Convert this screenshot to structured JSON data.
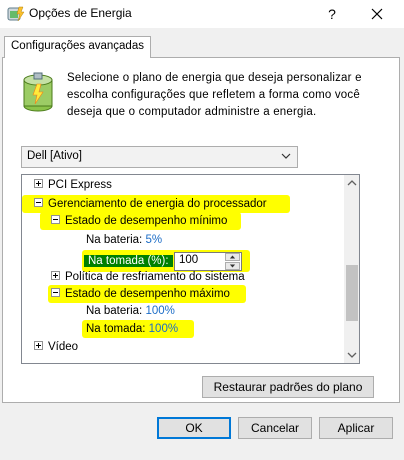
{
  "window": {
    "title": "Opções de Energia",
    "help_label": "?"
  },
  "tab": {
    "label": "Configurações avançadas"
  },
  "description": "Selecione o plano de energia que deseja personalizar e escolha configurações que refletem a forma como você deseja que o computador administre a energia.",
  "plan_dropdown": {
    "selected": "Dell [Ativo]"
  },
  "tree": {
    "pci_express": "PCI Express",
    "cpu_power": "Gerenciamento de energia do processador",
    "min_state": "Estado de desempenho mínimo",
    "min_battery_label": "Na bateria:",
    "min_battery_value": "5%",
    "min_plugged_label": "Na tomada (%):",
    "min_plugged_value": "100",
    "cooling_policy": "Política de resfriamento do sistema",
    "max_state": "Estado de desempenho máximo",
    "max_battery_label": "Na bateria:",
    "max_battery_value": "100%",
    "max_plugged_label": "Na tomada:",
    "max_plugged_value": "100%",
    "video": "Vídeo"
  },
  "restore_button": "Restaurar padrões do plano",
  "footer": {
    "ok": "OK",
    "cancel": "Cancelar",
    "apply": "Aplicar"
  },
  "colors": {
    "highlight": "#ffff00",
    "selected_row": "#008000",
    "value_link": "#1c6dc7"
  }
}
